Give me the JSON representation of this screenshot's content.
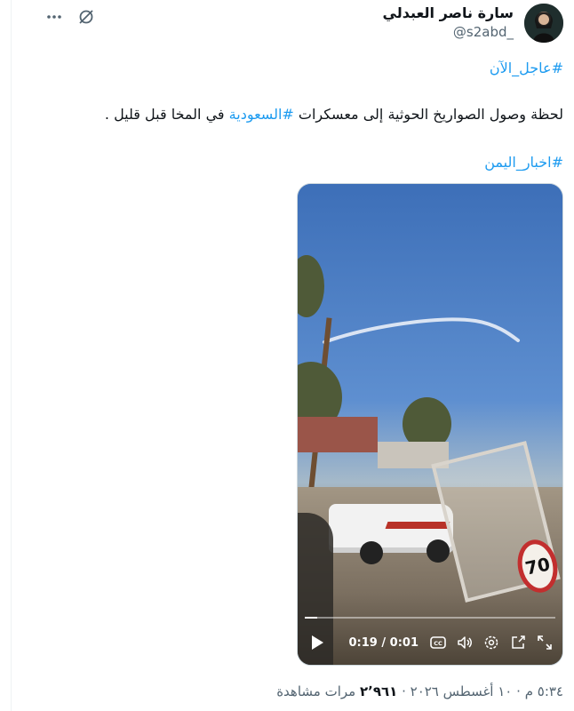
{
  "author": {
    "display_name": "سارة ناصر العبدلي",
    "handle": "@s2abd_"
  },
  "post": {
    "hashtag_top": "#عاجل_الآن",
    "sentence_part1": "لحظة وصول الصواريخ الحوثية إلى معسكرات ",
    "sentence_hashtag": "#السعودية",
    "sentence_part2": " في المخا قبل قليل .",
    "hashtag_bottom": "#اخبار_اليمن"
  },
  "video": {
    "time_display": "0:19 / 0:01",
    "progress_fraction": 0.05,
    "speed_sign_text": "70"
  },
  "meta": {
    "time": "٥:٣٤ م",
    "date": "١٠ أغسطس ٢٠٢٦",
    "views_count": "٢٬٩٦١",
    "views_label": "مرات مشاهدة",
    "separator": "·"
  },
  "colors": {
    "link": "#1d9bf0",
    "secondary_text": "#536471",
    "primary_text": "#0f1419"
  },
  "icons": {
    "grok": "grok-icon",
    "more": "more-icon",
    "play": "play-icon",
    "captions": "captions-icon",
    "volume": "volume-icon",
    "settings": "settings-icon",
    "pip": "pip-icon",
    "fullscreen": "fullscreen-icon"
  }
}
